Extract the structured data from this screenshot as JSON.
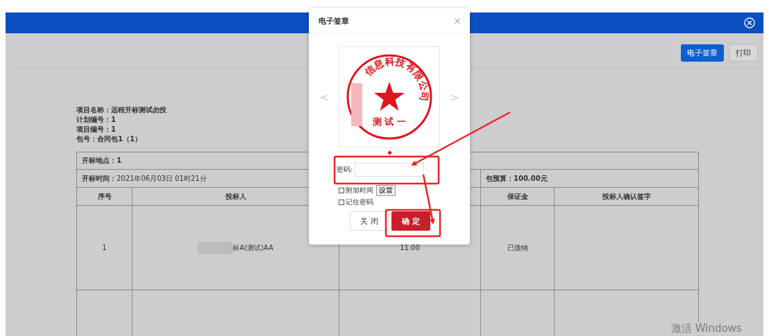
{
  "toolbar": {
    "buttons": [
      {
        "label": "电子签章",
        "kind": "primary"
      },
      {
        "label": "打印",
        "kind": "default"
      }
    ]
  },
  "project_info": [
    "项目名称：远程开标测试勿投",
    "计划编号：1",
    "项目编号：1",
    "包号：合同包1（1）"
  ],
  "table": {
    "location": "开标地点：1",
    "time_label": "开标时间：",
    "time_value": "2021年06月03日 01时21分",
    "budget": "包预算：100.00元",
    "columns": [
      {
        "label": "序号"
      },
      {
        "label": "投标人"
      },
      {},
      {
        "label": "保证金"
      },
      {
        "label": "投标人确认签字"
      }
    ],
    "rows": [
      {
        "cells": [
          "1",
          "标A(测试)AA",
          "11.00",
          "已缴纳"
        ],
        "redacted": true
      }
    ]
  },
  "modal": {
    "title": "电子签章",
    "close": "×",
    "stamp": {
      "arc_text": "信息科技有限公司",
      "bottom_text": "测 试 一",
      "redacted": true
    },
    "prev": "<",
    "next": ">",
    "password_label": "密码:",
    "options": [
      {
        "label": "附加时间",
        "checked": false,
        "button": "设置"
      },
      {
        "label": "记住密码",
        "checked": false
      }
    ],
    "buttons": [
      {
        "label": "关 闭",
        "kind": "default"
      },
      {
        "label": "确 定",
        "kind": "primary"
      }
    ]
  },
  "os_notice": "激活 Windows"
}
